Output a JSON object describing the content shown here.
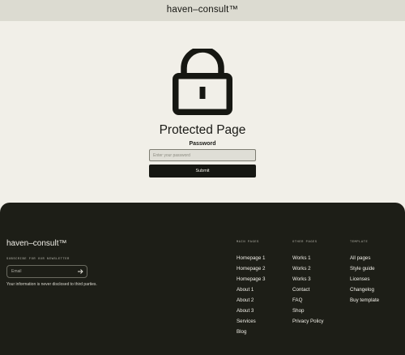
{
  "header": {
    "brand": "haven–consult™"
  },
  "main": {
    "title": "Protected Page",
    "password_label": "Password",
    "password_placeholder": "Enter your password",
    "submit_label": "Submit"
  },
  "footer": {
    "brand": "haven–consult™",
    "subscribe_label": "SUBSCRIBE FOR OUR NEWSLETTER",
    "email_placeholder": "Email",
    "privacy_note": "Your information is never disclosed to third parties.",
    "columns": [
      {
        "heading": "MAIN PAGES",
        "links": [
          "Homepage 1",
          "Homepage 2",
          "Homepage 3",
          "About 1",
          "About 2",
          "About 3",
          "Services",
          "Blog"
        ]
      },
      {
        "heading": "OTHER PAGES",
        "links": [
          "Works 1",
          "Works 2",
          "Works 3",
          "Contact",
          "FAQ",
          "Shop",
          "Privacy Policy"
        ]
      },
      {
        "heading": "TEMPLATE",
        "links": [
          "All pages",
          "Style guide",
          "Licenses",
          "Changelog",
          "Buy template"
        ]
      }
    ]
  },
  "icons": {
    "lock": "lock-icon",
    "arrow": "arrow-right-icon"
  },
  "colors": {
    "background": "#f1efe8",
    "topbar": "#dcdbd1",
    "footer": "#1d1e17",
    "button": "#161712"
  }
}
